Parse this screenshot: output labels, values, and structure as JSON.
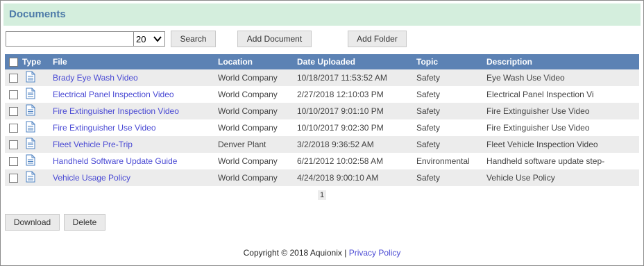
{
  "panel": {
    "title": "Documents"
  },
  "toolbar": {
    "search_value": "",
    "page_size": "20",
    "search_label": "Search",
    "add_document_label": "Add Document",
    "add_folder_label": "Add Folder"
  },
  "table": {
    "columns": [
      "Type",
      "File",
      "Location",
      "Date Uploaded",
      "Topic",
      "Description"
    ],
    "rows": [
      {
        "file": "Brady Eye Wash Video",
        "location": "World Company",
        "date": "10/18/2017 11:53:52 AM",
        "topic": "Safety",
        "description": "Eye Wash Use Video"
      },
      {
        "file": "Electrical Panel Inspection Video",
        "location": "World Company",
        "date": "2/27/2018 12:10:03 PM",
        "topic": "Safety",
        "description": "Electrical Panel Inspection Vi"
      },
      {
        "file": "Fire Extinguisher Inspection Video",
        "location": "World Company",
        "date": "10/10/2017 9:01:10 PM",
        "topic": "Safety",
        "description": "Fire Extinguisher Use Video"
      },
      {
        "file": "Fire Extinguisher Use Video",
        "location": "World Company",
        "date": "10/10/2017 9:02:30 PM",
        "topic": "Safety",
        "description": "Fire Extinguisher Use Video"
      },
      {
        "file": "Fleet Vehicle Pre-Trip",
        "location": "Denver Plant",
        "date": "3/2/2018 9:36:52 AM",
        "topic": "Safety",
        "description": "Fleet Vehicle Inspection Video"
      },
      {
        "file": "Handheld Software Update Guide",
        "location": "World Company",
        "date": "6/21/2012 10:02:58 AM",
        "topic": "Environmental",
        "description": "Handheld software update step-"
      },
      {
        "file": "Vehicle Usage Policy",
        "location": "World Company",
        "date": "4/24/2018 9:00:10 AM",
        "topic": "Safety",
        "description": "Vehicle Use Policy"
      }
    ]
  },
  "pager": {
    "current": "1"
  },
  "actions": {
    "download_label": "Download",
    "delete_label": "Delete"
  },
  "footer": {
    "copyright": "Copyright © 2018 Aquionix |",
    "privacy_label": "Privacy Policy"
  },
  "colors": {
    "header_bg": "#d4eedd",
    "title": "#4d7aa8",
    "table_header": "#5c82b4",
    "link": "#4a4ad4"
  }
}
